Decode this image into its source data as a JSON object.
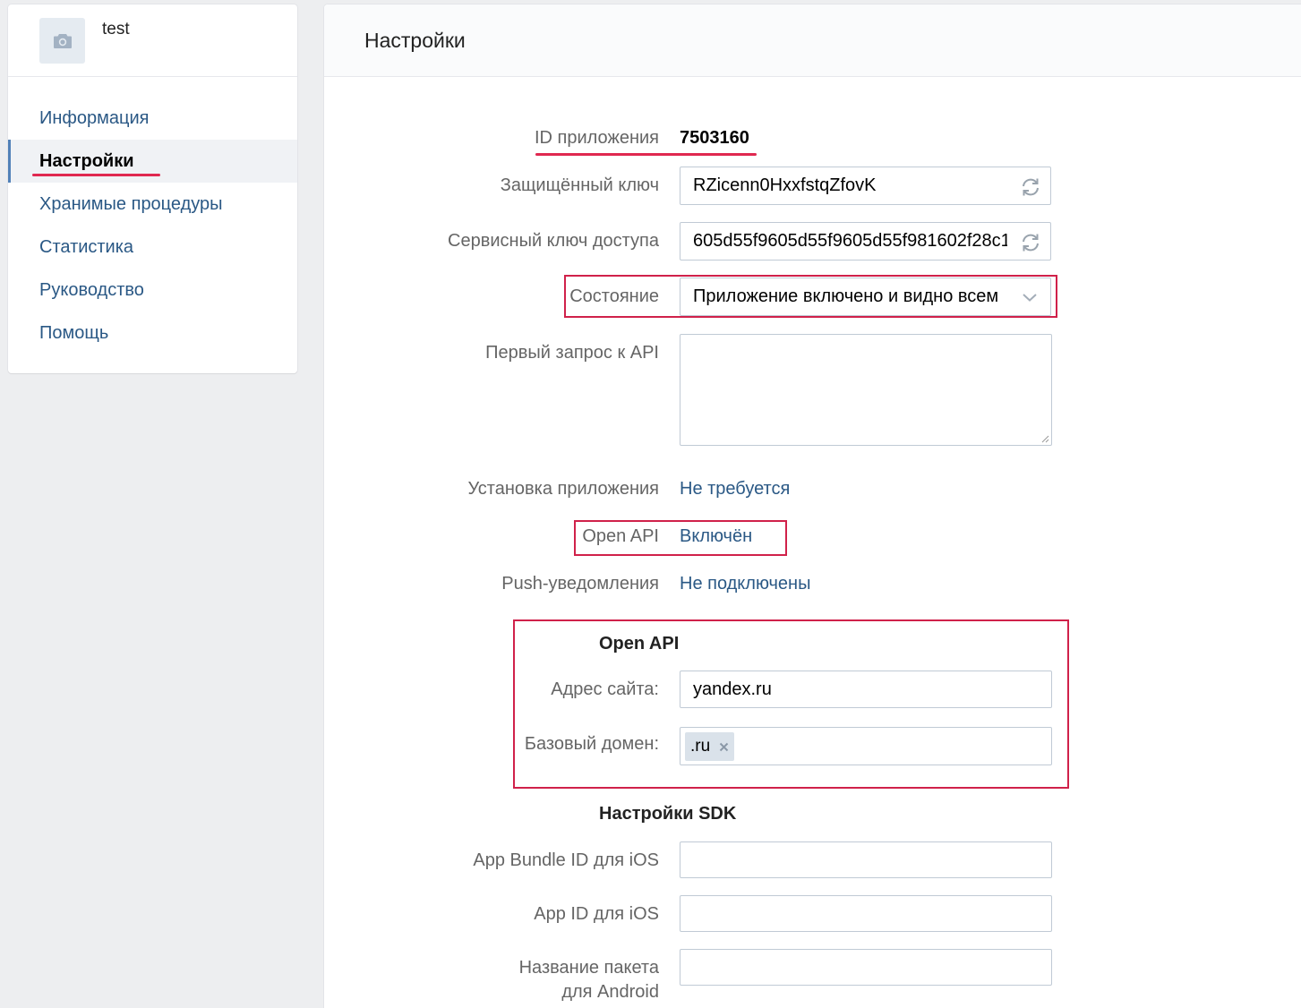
{
  "app": {
    "name": "test",
    "avatar_icon": "camera-icon"
  },
  "sidebar": {
    "items": [
      {
        "label": "Информация"
      },
      {
        "label": "Настройки",
        "active": true
      },
      {
        "label": "Хранимые процедуры"
      },
      {
        "label": "Статистика"
      },
      {
        "label": "Руководство"
      },
      {
        "label": "Помощь"
      }
    ]
  },
  "main": {
    "title": "Настройки",
    "app_id": {
      "label": "ID приложения",
      "value": "7503160"
    },
    "secure_key": {
      "label": "Защищённый ключ",
      "value": "RZicenn0HxxfstqZfovK",
      "icon": "refresh-icon"
    },
    "service_key": {
      "label": "Сервисный ключ доступа",
      "value": "605d55f9605d55f9605d55f981602f28c1",
      "icon": "refresh-icon"
    },
    "state": {
      "label": "Состояние",
      "value": "Приложение включено и видно всем",
      "icon": "chevron-down-icon"
    },
    "first_api_request": {
      "label": "Первый запрос к API",
      "value": ""
    },
    "install": {
      "label": "Установка приложения",
      "value": "Не требуется"
    },
    "open_api": {
      "label": "Open API",
      "value": "Включён"
    },
    "push": {
      "label": "Push-уведомления",
      "value": "Не подключены"
    },
    "open_api_section": {
      "title": "Open API",
      "site_address": {
        "label": "Адрес сайта:",
        "value": "yandex.ru"
      },
      "base_domain": {
        "label": "Базовый домен:",
        "tokens": [
          ".ru"
        ],
        "remove_icon": "close-icon"
      }
    },
    "sdk_section": {
      "title": "Настройки SDK",
      "ios_bundle": {
        "label": "App Bundle ID для iOS",
        "value": ""
      },
      "ios_app_id": {
        "label": "App ID для iOS",
        "value": ""
      },
      "android_package": {
        "label_line1": "Название пакета",
        "label_line2": "для Android",
        "value": ""
      }
    }
  },
  "colors": {
    "link": "#2a5885",
    "highlight": "#d0214a",
    "input_border": "#c0cad5"
  }
}
